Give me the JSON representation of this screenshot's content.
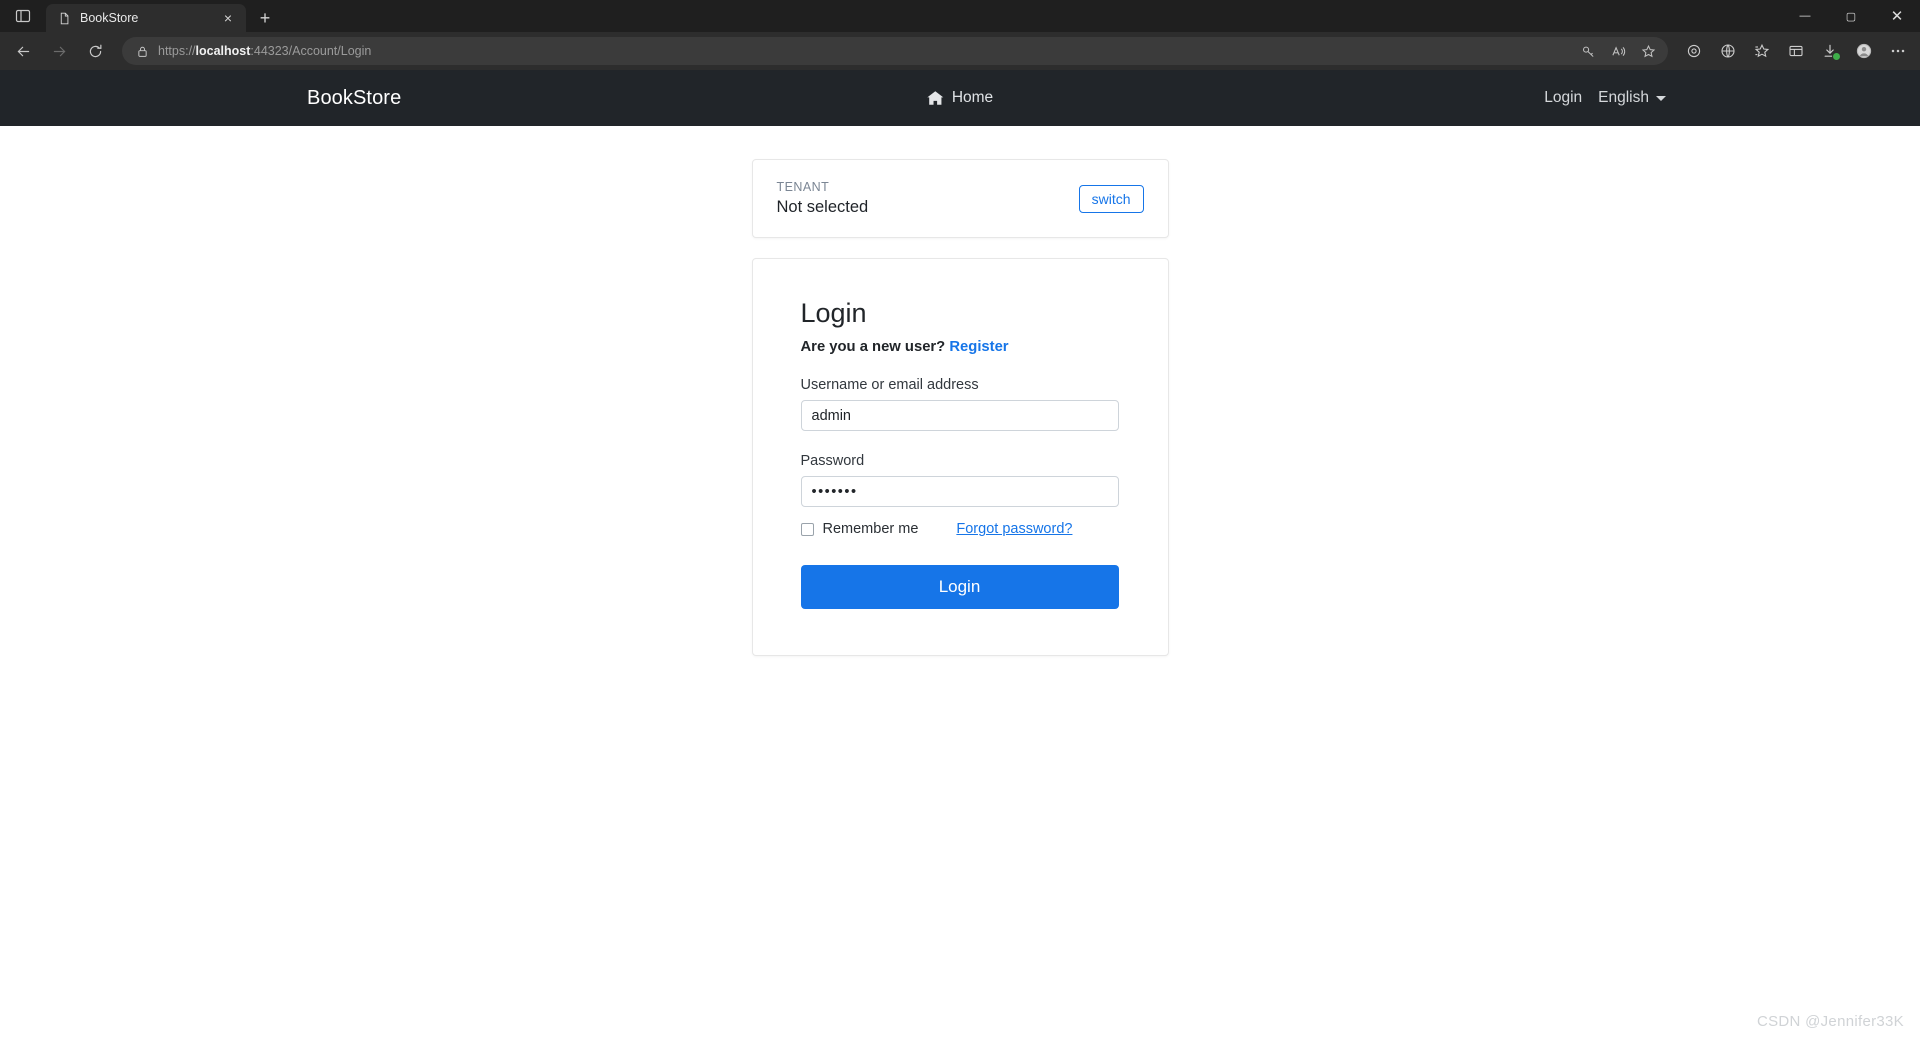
{
  "browser": {
    "tab": {
      "title": "BookStore",
      "favicon": "document-icon",
      "close": "×"
    },
    "new_tab_label": "+",
    "tab_strip_icon": "tab-list-icon",
    "window_controls": {
      "minimize": "—",
      "maximize": "▢",
      "close": "✕"
    },
    "nav": {
      "back": "back-arrow-icon",
      "forward": "forward-arrow-icon",
      "reload": "reload-icon"
    },
    "address": {
      "lock_icon": "lock-icon",
      "url_full": "https://localhost:44323/Account/Login",
      "url_prefix": "https://",
      "url_host_bold": "localhost",
      "url_suffix": ":44323/Account/Login"
    },
    "omni_icons": [
      "key-icon",
      "read-aloud-icon",
      "favorite-star-icon"
    ],
    "toolbar_icons": [
      "extension-puzzle-icon",
      "browser-essentials-icon",
      "favorites-icon",
      "collections-icon",
      "downloads-icon",
      "profile-avatar-icon",
      "settings-more-icon"
    ]
  },
  "navbar": {
    "brand": "BookStore",
    "home_label": "Home",
    "home_icon": "house-icon",
    "login_label": "Login",
    "language_label": "English",
    "caret_icon": "caret-down-icon"
  },
  "tenant_card": {
    "label": "TENANT",
    "value": "Not selected",
    "switch_label": "switch"
  },
  "login_card": {
    "title": "Login",
    "new_user_text": "Are you a new user?",
    "register_label": "Register",
    "username": {
      "label": "Username or email address",
      "value": "admin",
      "placeholder": ""
    },
    "password": {
      "label": "Password",
      "value": "•••••••",
      "placeholder": ""
    },
    "remember_label": "Remember me",
    "remember_checked": false,
    "forgot_label": "Forgot password?",
    "submit_label": "Login"
  },
  "watermark": "CSDN @Jennifer33K",
  "colors": {
    "navbar_bg": "#212529",
    "accent_blue": "#1675e8",
    "chrome_dark": "#2d2d2d",
    "titlebar": "#1f1f1f"
  }
}
